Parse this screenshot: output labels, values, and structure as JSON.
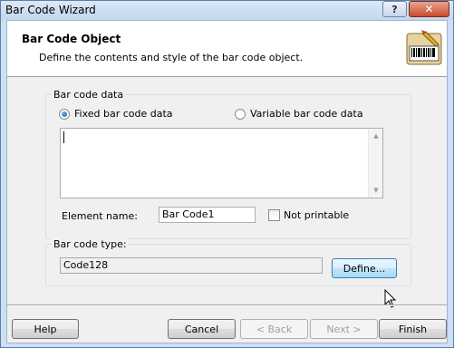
{
  "window": {
    "title": "Bar Code Wizard",
    "help_glyph": "?",
    "close_glyph": "✕"
  },
  "header": {
    "title": "Bar Code Object",
    "subtitle": "Define the contents and style of the bar code object.",
    "icon": "barcode-wizard-icon"
  },
  "barcode_data": {
    "group_label": "Bar code data",
    "fixed_label": "Fixed bar code data",
    "variable_label": "Variable bar code data",
    "selected": "fixed",
    "data_value": "",
    "element_name_label": "Element name:",
    "element_name_value": "Bar Code1",
    "not_printable_label": "Not printable",
    "not_printable_checked": false
  },
  "barcode_type": {
    "group_label": "Bar code type:",
    "value": "Code128",
    "define_label": "Define..."
  },
  "buttons": {
    "help": "Help",
    "cancel": "Cancel",
    "back": "< Back",
    "next": "Next >",
    "finish": "Finish"
  }
}
